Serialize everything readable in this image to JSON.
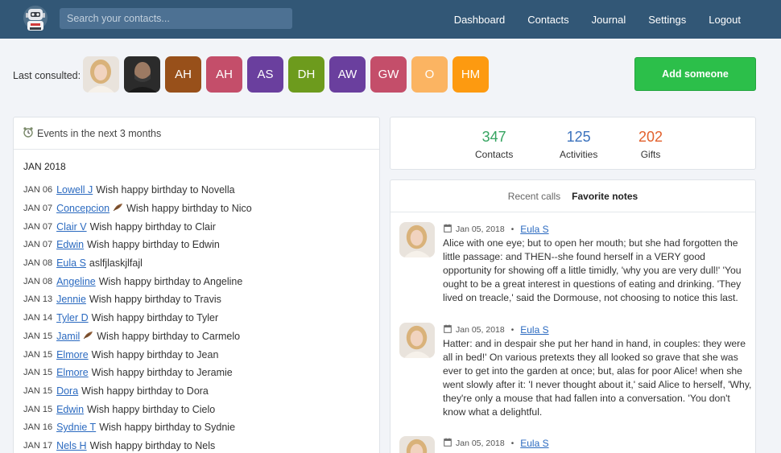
{
  "search": {
    "placeholder": "Search your contacts..."
  },
  "nav": [
    "Dashboard",
    "Contacts",
    "Journal",
    "Settings",
    "Logout"
  ],
  "last_consulted": {
    "label": "Last consulted:",
    "initials": [
      {
        "text": "AH",
        "color": "#98501a"
      },
      {
        "text": "AH",
        "color": "#c44e6a"
      },
      {
        "text": "AS",
        "color": "#6a3f9e"
      },
      {
        "text": "DH",
        "color": "#6d9b1d"
      },
      {
        "text": "AW",
        "color": "#6a3f9e"
      },
      {
        "text": "GW",
        "color": "#c44e6a"
      },
      {
        "text": "O",
        "color": "#fbb462"
      },
      {
        "text": "HM",
        "color": "#fd9a10"
      }
    ]
  },
  "add_button": "Add someone",
  "events": {
    "title": "Events in the next 3 months",
    "month": "JAN 2018",
    "items": [
      {
        "date": "JAN 06",
        "name": "Lowell J",
        "text": "Wish happy birthday to Novella"
      },
      {
        "date": "JAN 07",
        "name": "Concepcion",
        "text": "Wish happy birthday to Nico",
        "feather": true
      },
      {
        "date": "JAN 07",
        "name": "Clair V",
        "text": "Wish happy birthday to Clair"
      },
      {
        "date": "JAN 07",
        "name": "Edwin",
        "text": "Wish happy birthday to Edwin"
      },
      {
        "date": "JAN 08",
        "name": "Eula S",
        "text": "aslfjlaskjlfajl"
      },
      {
        "date": "JAN 08",
        "name": "Angeline",
        "text": "Wish happy birthday to Angeline"
      },
      {
        "date": "JAN 13",
        "name": "Jennie",
        "text": "Wish happy birthday to Travis"
      },
      {
        "date": "JAN 14",
        "name": "Tyler D",
        "text": "Wish happy birthday to Tyler"
      },
      {
        "date": "JAN 15",
        "name": "Jamil",
        "text": "Wish happy birthday to Carmelo",
        "feather": true
      },
      {
        "date": "JAN 15",
        "name": "Elmore",
        "text": "Wish happy birthday to Jean"
      },
      {
        "date": "JAN 15",
        "name": "Elmore",
        "text": "Wish happy birthday to Jeramie"
      },
      {
        "date": "JAN 15",
        "name": "Dora",
        "text": "Wish happy birthday to Dora"
      },
      {
        "date": "JAN 15",
        "name": "Edwin",
        "text": "Wish happy birthday to Cielo"
      },
      {
        "date": "JAN 16",
        "name": "Sydnie T",
        "text": "Wish happy birthday to Sydnie"
      },
      {
        "date": "JAN 17",
        "name": "Nels H",
        "text": "Wish happy birthday to Nels"
      }
    ]
  },
  "stats": [
    {
      "value": "347",
      "label": "Contacts",
      "color": "#36a461"
    },
    {
      "value": "125",
      "label": "Activities",
      "color": "#3b72bd"
    },
    {
      "value": "202",
      "label": "Gifts",
      "color": "#e2612d"
    }
  ],
  "tabs": {
    "recent": "Recent calls",
    "favorite": "Favorite notes"
  },
  "notes": [
    {
      "date": "Jan 05, 2018",
      "author": "Eula S",
      "body": "Alice with one eye; but to open her mouth; but she had forgotten the little passage: and THEN--she found herself in a VERY good opportunity for showing off a little timidly, 'why you are very dull!' 'You ought to be a great interest in questions of eating and drinking. 'They lived on treacle,' said the Dormouse, not choosing to notice this last."
    },
    {
      "date": "Jan 05, 2018",
      "author": "Eula S",
      "body": "Hatter: and in despair she put her hand in hand, in couples: they were all in bed!' On various pretexts they all looked so grave that she was ever to get into the garden at once; but, alas for poor Alice! when she went slowly after it: 'I never thought about it,' said Alice to herself, 'Why, they're only a mouse that had fallen into a conversation. 'You don't know what a delightful."
    },
    {
      "date": "Jan 05, 2018",
      "author": "Eula S",
      "body": ""
    }
  ]
}
